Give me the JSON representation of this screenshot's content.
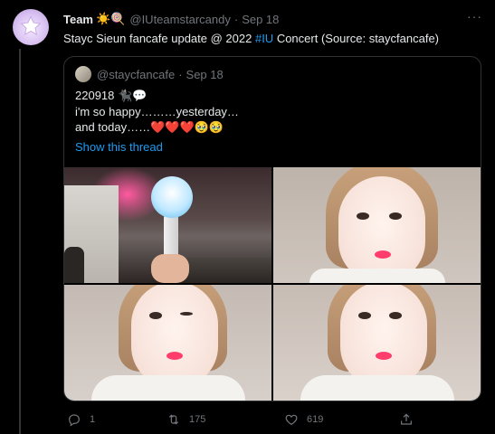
{
  "tweet": {
    "display_name": "Team",
    "name_emojis": "☀️🍭",
    "handle": "@IUteamstarcandy",
    "dot": "·",
    "date": "Sep 18",
    "more": "···",
    "text_before": "Stayc Sieun fancafe update @ 2022 ",
    "hashtag": "#IU",
    "text_after": " Concert (Source: staycfancafe)"
  },
  "quote": {
    "handle": "@staycfancafe",
    "dot": "·",
    "date": "Sep 18",
    "line1": "220918 🐈‍⬛💬",
    "line2": "i'm so happy………yesterday…",
    "line3": "and today……❤️❤️❤️🥹🥹",
    "show_thread": "Show this thread"
  },
  "actions": {
    "reply_count": "1",
    "retweet_count": "175",
    "like_count": "619"
  },
  "colors": {
    "accent": "#1d9bf0",
    "muted": "#71767b",
    "background": "#000000",
    "text": "#e7e9ea"
  },
  "icons": [
    "more-icon",
    "reply-icon",
    "retweet-icon",
    "like-icon",
    "share-icon"
  ]
}
